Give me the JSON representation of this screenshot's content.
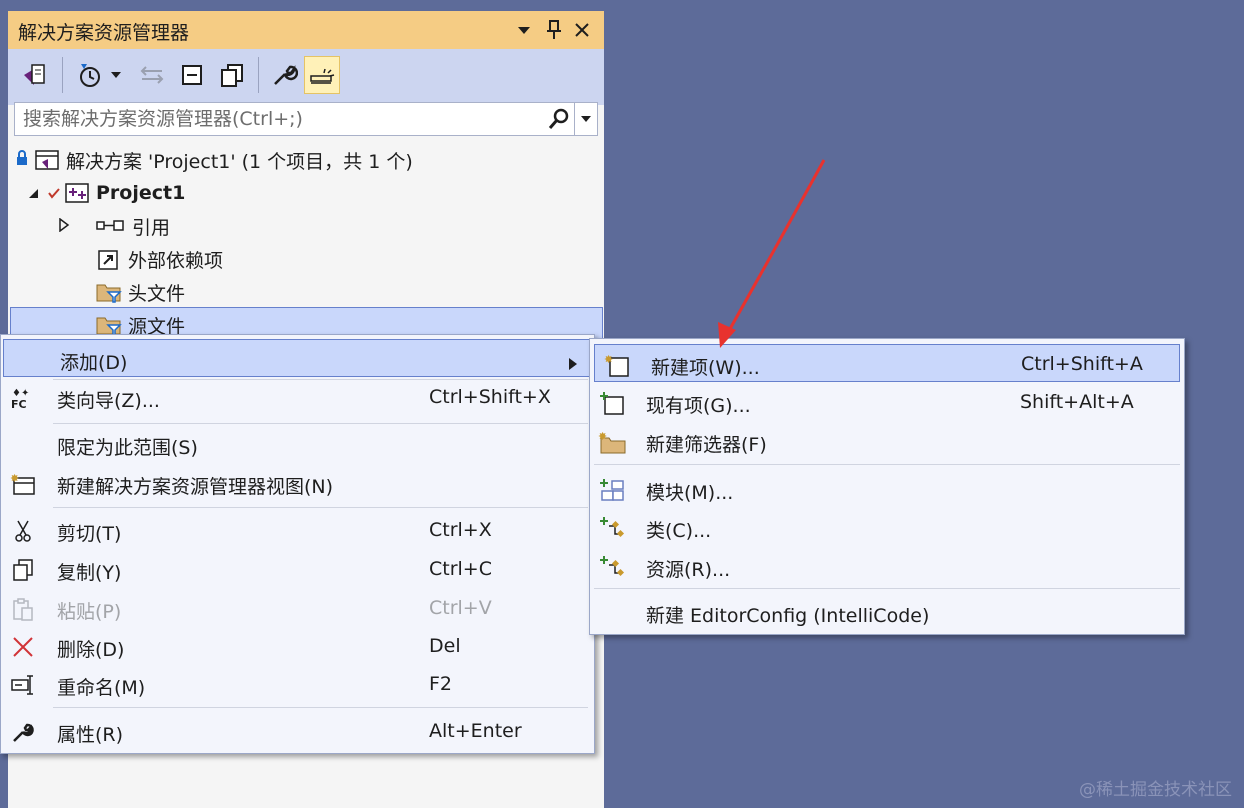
{
  "panel": {
    "title": "解决方案资源管理器",
    "title_buttons": [
      "▼",
      "ᛘ",
      "✕"
    ]
  },
  "search": {
    "placeholder": "搜索解决方案资源管理器(Ctrl+;)"
  },
  "tree": {
    "solution": "解决方案 'Project1' (1 个项目，共 1 个)",
    "project": "Project1",
    "items": [
      "引用",
      "外部依赖项",
      "头文件",
      "源文件"
    ]
  },
  "context_menu": {
    "items": [
      {
        "label": "添加(D)",
        "shortcut": "",
        "icon": "none"
      },
      {
        "label": "类向导(Z)...",
        "shortcut": "Ctrl+Shift+X",
        "icon": "class-wizard-icon"
      },
      {
        "label": "限定为此范围(S)",
        "shortcut": "",
        "icon": "none"
      },
      {
        "label": "新建解决方案资源管理器视图(N)",
        "shortcut": "",
        "icon": "new-view-icon"
      },
      {
        "label": "剪切(T)",
        "shortcut": "Ctrl+X",
        "icon": "cut-icon"
      },
      {
        "label": "复制(Y)",
        "shortcut": "Ctrl+C",
        "icon": "copy-icon"
      },
      {
        "label": "粘贴(P)",
        "shortcut": "Ctrl+V",
        "icon": "paste-icon"
      },
      {
        "label": "删除(D)",
        "shortcut": "Del",
        "icon": "delete-icon"
      },
      {
        "label": "重命名(M)",
        "shortcut": "F2",
        "icon": "rename-icon"
      },
      {
        "label": "属性(R)",
        "shortcut": "Alt+Enter",
        "icon": "wrench-icon"
      }
    ]
  },
  "submenu": {
    "items": [
      {
        "label": "新建项(W)...",
        "shortcut": "Ctrl+Shift+A",
        "icon": "new-item-icon"
      },
      {
        "label": "现有项(G)...",
        "shortcut": "Shift+Alt+A",
        "icon": "existing-item-icon"
      },
      {
        "label": "新建筛选器(F)",
        "shortcut": "",
        "icon": "new-filter-icon"
      },
      {
        "label": "模块(M)...",
        "shortcut": "",
        "icon": "module-icon"
      },
      {
        "label": "类(C)...",
        "shortcut": "",
        "icon": "class-icon"
      },
      {
        "label": "资源(R)...",
        "shortcut": "",
        "icon": "resource-icon"
      },
      {
        "label": "新建 EditorConfig (IntelliCode)",
        "shortcut": "",
        "icon": "none"
      }
    ]
  },
  "watermark": "@稀土掘金技术社区",
  "colors": {
    "background": "#5d6b99",
    "title_bar": "#f5cc84",
    "toolbar": "#ccd5f0",
    "highlight": "#c9d7fb",
    "arrow": "#e8322e"
  }
}
